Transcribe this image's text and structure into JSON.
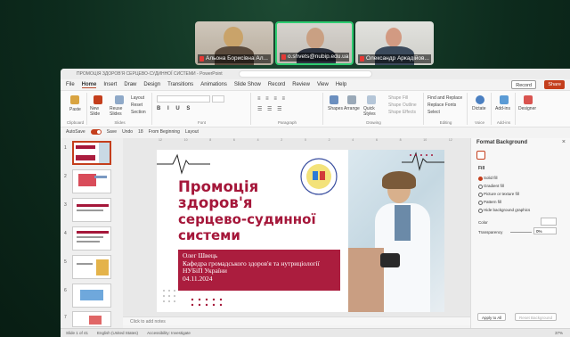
{
  "participants": [
    {
      "name": "Альона Борисівна Ал..."
    },
    {
      "name": "o.shvets@nubip.edu.ua"
    },
    {
      "name": "Олександр Аркадійов..."
    }
  ],
  "app": {
    "window_title": "ПРОМОЦІЯ ЗДОРОВ'Я СЕРЦЕВО-СУДИННОЇ СИСТЕМИ - PowerPoint",
    "menu": [
      "File",
      "Home",
      "Insert",
      "Draw",
      "Design",
      "Transitions",
      "Animations",
      "Slide Show",
      "Record",
      "Review",
      "View",
      "Help"
    ],
    "active_menu": "Home",
    "record_label": "Record",
    "share_label": "Share",
    "ribbon": {
      "paste": "Paste",
      "new_slide": "New Slide",
      "reuse_slides": "Reuse Slides",
      "layout": "Layout",
      "reset": "Reset",
      "section": "Section",
      "shapes": "Shapes",
      "arrange": "Arrange",
      "quick_styles": "Quick Styles",
      "shape_fill": "Shape Fill",
      "shape_outline": "Shape Outline",
      "shape_effects": "Shape Effects",
      "find_replace": "Find and Replace",
      "replace_fonts": "Replace Fonts",
      "select": "Select",
      "dictate": "Dictate",
      "addins": "Add-ins",
      "designer": "Designer",
      "groups": [
        "Clipboard",
        "Slides",
        "Font",
        "Paragraph",
        "Drawing",
        "Editing",
        "Voice",
        "Add-ins"
      ]
    },
    "quick_access": {
      "autosave": "AutoSave",
      "save": "Save",
      "undo": "Undo",
      "font_size": "18",
      "from_beginning": "From Beginning",
      "layout": "Layout"
    },
    "slide": {
      "title_line1": "Промоція",
      "title_line2": "здоров'я",
      "title_line3": "серцево-судинної",
      "title_line4": "системи",
      "author": "Олег Швець",
      "department": "Кафедра громадського здоров'я та нутриціології НУБіП України",
      "date": "04.11.2024"
    },
    "notes_placeholder": "Click to add notes",
    "thumbnail_numbers": [
      "1",
      "2",
      "3",
      "4",
      "5",
      "6",
      "7"
    ],
    "format_pane": {
      "title": "Format Background",
      "section": "Fill",
      "options": [
        "Solid fill",
        "Gradient fill",
        "Picture or texture fill",
        "Pattern fill",
        "Hide background graphics"
      ],
      "selected": "Solid fill",
      "color_label": "Color",
      "transparency_label": "Transparency",
      "transparency_value": "0%",
      "apply_all": "Apply to All",
      "reset_bg": "Reset Background"
    },
    "status": {
      "slide": "Slide 1 of 41",
      "language": "English (United States)",
      "accessibility": "Accessibility: Investigate",
      "zoom": "37%"
    }
  },
  "colors": {
    "accent": "#c43e1c",
    "slide_red": "#a5173a",
    "meeting_bg": "#0d2b1d"
  }
}
